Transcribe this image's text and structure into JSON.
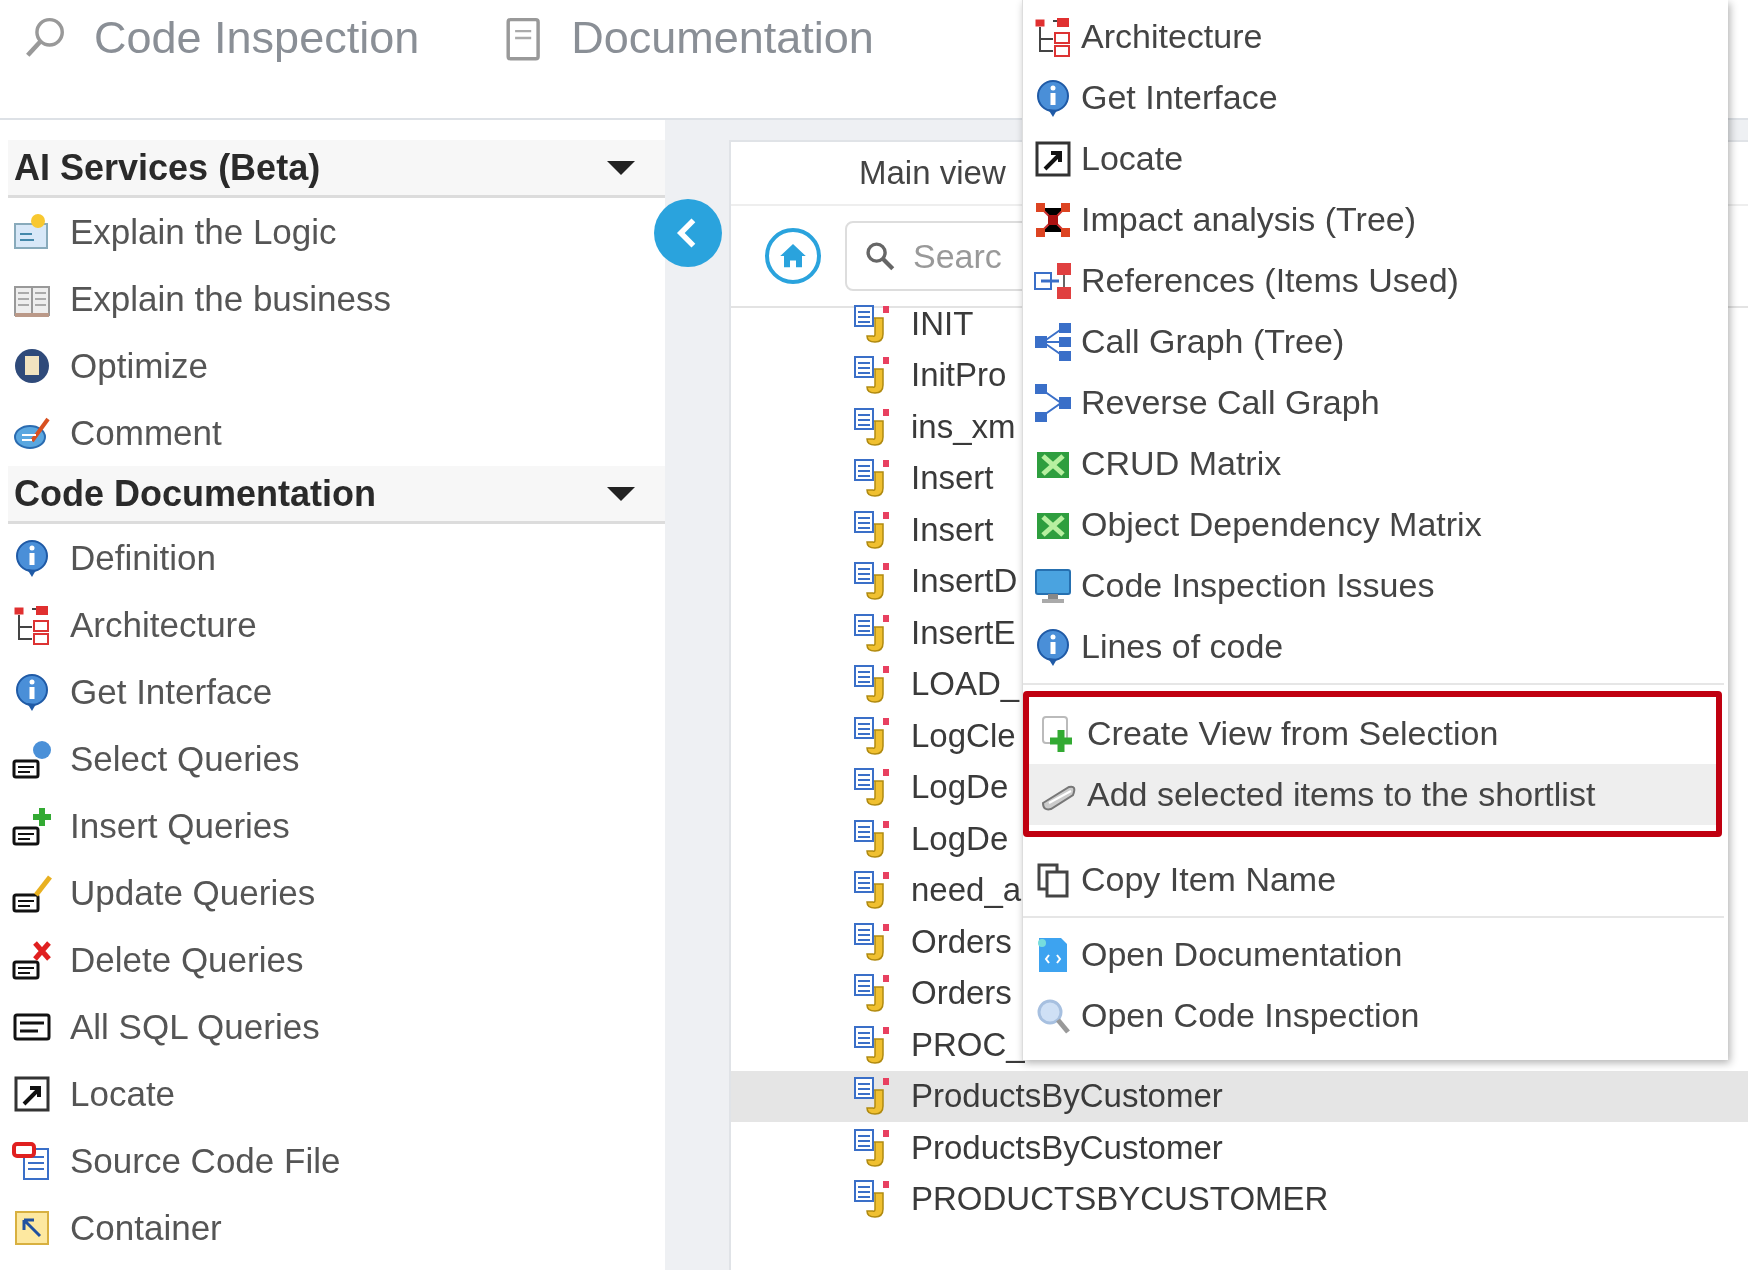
{
  "top_tabs": [
    {
      "label": "Code Inspection"
    },
    {
      "label": "Documentation"
    }
  ],
  "sidebar": {
    "sections": [
      {
        "title": "AI Services (Beta)",
        "expanded": true,
        "items": [
          "Explain the Logic",
          "Explain the business",
          "Optimize",
          "Comment"
        ]
      },
      {
        "title": "Code Documentation",
        "expanded": true,
        "items": [
          "Definition",
          "Architecture",
          "Get Interface",
          "Select Queries",
          "Insert Queries",
          "Update Queries",
          "Delete Queries",
          "All SQL Queries",
          "Locate",
          "Source Code File",
          "Container"
        ]
      }
    ]
  },
  "main_view": {
    "title": "Main view",
    "search": {
      "placeholder": "Searc"
    },
    "items": [
      {
        "name": "INIT",
        "selected": false
      },
      {
        "name": "InitPro",
        "selected": false
      },
      {
        "name": "ins_xm",
        "selected": false
      },
      {
        "name": "Insert",
        "selected": false
      },
      {
        "name": "Insert",
        "selected": false
      },
      {
        "name": "InsertD",
        "selected": false
      },
      {
        "name": "InsertE",
        "selected": false
      },
      {
        "name": "LOAD_",
        "selected": false
      },
      {
        "name": "LogCle",
        "selected": false
      },
      {
        "name": "LogDe",
        "selected": false
      },
      {
        "name": "LogDe",
        "selected": false
      },
      {
        "name": "need_a",
        "selected": false
      },
      {
        "name": "Orders",
        "selected": false
      },
      {
        "name": "Orders",
        "selected": false
      },
      {
        "name": "PROC_",
        "selected": false
      },
      {
        "name": "ProductsByCustomer",
        "selected": true
      },
      {
        "name": "ProductsByCustomer",
        "selected": false
      },
      {
        "name": "PRODUCTSBYCUSTOMER",
        "selected": false
      }
    ]
  },
  "context_menu": {
    "groups": [
      {
        "annotated": false,
        "items": [
          {
            "label": "Architecture",
            "selected": false
          },
          {
            "label": "Get Interface",
            "selected": false
          },
          {
            "label": "Locate",
            "selected": false
          },
          {
            "label": "Impact analysis (Tree)",
            "selected": false
          },
          {
            "label": "References (Items Used)",
            "selected": false
          },
          {
            "label": "Call Graph (Tree)",
            "selected": false
          },
          {
            "label": "Reverse Call Graph",
            "selected": false
          },
          {
            "label": "CRUD Matrix",
            "selected": false
          },
          {
            "label": "Object Dependency Matrix",
            "selected": false
          },
          {
            "label": "Code Inspection Issues",
            "selected": false
          },
          {
            "label": "Lines of code",
            "selected": false
          }
        ]
      },
      {
        "annotated": true,
        "items": [
          {
            "label": "Create View from Selection",
            "selected": false
          },
          {
            "label": "Add selected items to the shortlist",
            "selected": true
          }
        ]
      },
      {
        "annotated": false,
        "items": [
          {
            "label": "Copy Item Name",
            "selected": false
          }
        ]
      },
      {
        "annotated": false,
        "items": [
          {
            "label": "Open Documentation",
            "selected": false
          },
          {
            "label": "Open Code Inspection",
            "selected": false
          }
        ]
      }
    ]
  }
}
